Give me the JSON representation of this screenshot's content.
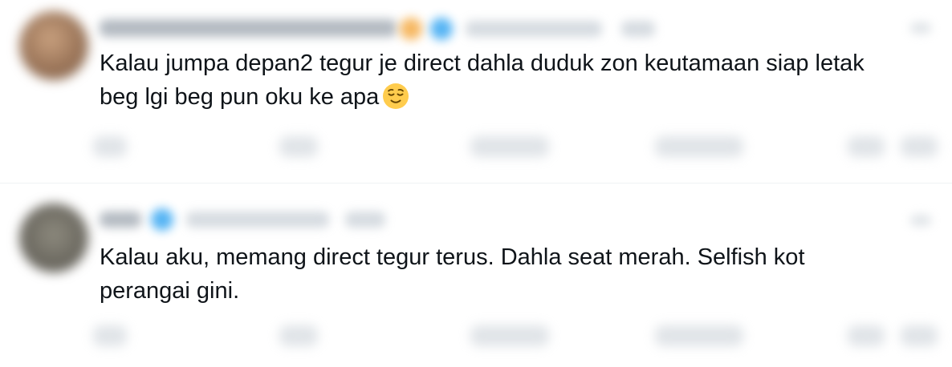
{
  "tweets": [
    {
      "text_line1": "Kalau jumpa depan2 tegur je direct dahla duduk zon keutamaan siap letak",
      "text_line2": "beg lgi beg pun oku ke apa",
      "emoji": "relieved-face"
    },
    {
      "text_line1": "Kalau aku, memang direct tegur terus. Dahla seat merah. Selfish kot",
      "text_line2": "perangai gini."
    }
  ]
}
